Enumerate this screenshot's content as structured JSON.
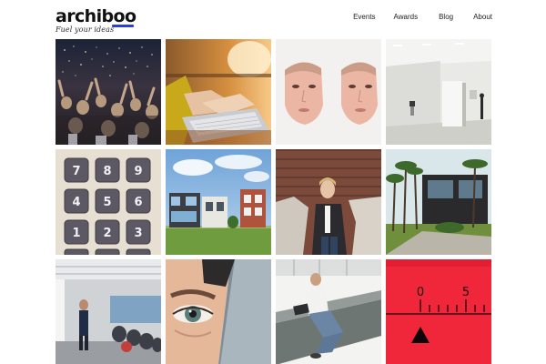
{
  "header": {
    "logo": "archiboo",
    "tagline": "Fuel your ideas",
    "nav": {
      "events": "Events",
      "awards": "Awards",
      "blog": "Blog",
      "about": "About"
    }
  },
  "colors": {
    "accent": "#2b3fd6",
    "timer_red": "#f0263a"
  },
  "grid": {
    "tiles": [
      {
        "subject": "concert-crowd-photo"
      },
      {
        "subject": "laptop-typing-photo"
      },
      {
        "subject": "face-masks-photo"
      },
      {
        "subject": "gallery-room-photo"
      },
      {
        "subject": "keypad-buttons-photo"
      },
      {
        "subject": "modern-houses-photo"
      },
      {
        "subject": "man-brick-wall-photo"
      },
      {
        "subject": "modern-building-trees-photo"
      },
      {
        "subject": "conference-speaker-photo"
      },
      {
        "subject": "eye-closeup-photo"
      },
      {
        "subject": "man-with-laptop-photo"
      },
      {
        "subject": "kitchen-timer-photo"
      }
    ],
    "keypad_digits": [
      "7",
      "8",
      "9",
      "4",
      "5",
      "6",
      "1",
      "2",
      "3"
    ],
    "timer_marks": [
      "0",
      "5"
    ]
  }
}
